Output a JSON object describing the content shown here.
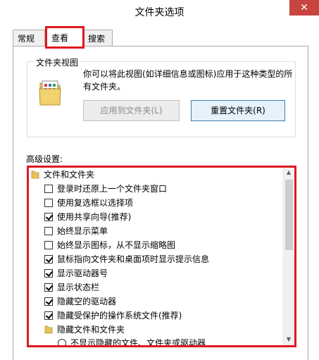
{
  "window": {
    "title": "文件夹选项",
    "close_glyph": "✕"
  },
  "tabs": [
    {
      "label": "常规"
    },
    {
      "label": "查看"
    },
    {
      "label": "搜索"
    }
  ],
  "folder_views": {
    "group_label": "文件夹视图",
    "description": "你可以将此视图(如详细信息或图标)应用于这种类型的所有文件夹。",
    "apply_button": "应用到文件夹(L)",
    "reset_button": "重置文件夹(R)"
  },
  "advanced": {
    "label": "高级设置:",
    "items": [
      {
        "type": "folder",
        "label": "文件和文件夹"
      },
      {
        "type": "checkbox",
        "checked": false,
        "label": "登录时还原上一个文件夹窗口"
      },
      {
        "type": "checkbox",
        "checked": false,
        "label": "使用复选框以选择项"
      },
      {
        "type": "checkbox",
        "checked": true,
        "label": "使用共享向导(推荐)"
      },
      {
        "type": "checkbox",
        "checked": false,
        "label": "始终显示菜单"
      },
      {
        "type": "checkbox",
        "checked": false,
        "label": "始终显示图标，从不显示缩略图"
      },
      {
        "type": "checkbox",
        "checked": true,
        "label": "鼠标指向文件夹和桌面项时显示提示信息"
      },
      {
        "type": "checkbox",
        "checked": true,
        "label": "显示驱动器号"
      },
      {
        "type": "checkbox",
        "checked": true,
        "label": "显示状态栏"
      },
      {
        "type": "checkbox",
        "checked": true,
        "label": "隐藏空的驱动器"
      },
      {
        "type": "checkbox",
        "checked": true,
        "label": "隐藏受保护的操作系统文件(推荐)"
      },
      {
        "type": "folder",
        "label": "隐藏文件和文件夹"
      },
      {
        "type": "radio",
        "checked": false,
        "label": "不显示隐藏的文件、文件夹或驱动器"
      }
    ]
  }
}
